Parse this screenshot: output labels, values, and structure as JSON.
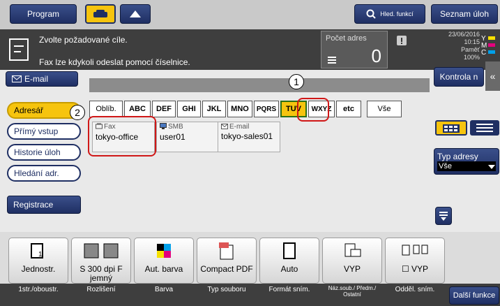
{
  "topbar": {
    "program": "Program",
    "search": "Hled. funkcí",
    "seznam": "Seznam úloh"
  },
  "message": {
    "line1": "Zvolte požadované cíle.",
    "line2": "Fax lze kdykoli odeslat pomocí číselnice.",
    "pocet_label": "Počet adres",
    "pocet_value": "0"
  },
  "status": {
    "date": "23/06/2016",
    "time": "10:15",
    "memory_label": "Paměť",
    "memory_value": "100%"
  },
  "tabs": {
    "email": "E-mail",
    "kontrola": "Kontrola n"
  },
  "sidebar": {
    "items": [
      {
        "label": "Adresář"
      },
      {
        "label": "Přímý vstup"
      },
      {
        "label": "Historie úloh"
      },
      {
        "label": "Hledání adr."
      },
      {
        "label": "Registrace"
      }
    ]
  },
  "index": {
    "items": [
      "Oblíb.",
      "ABC",
      "DEF",
      "GHI",
      "JKL",
      "MNO",
      "PQRS",
      "TUV",
      "WXYZ",
      "etc",
      "Vše"
    ],
    "selected": "TUV"
  },
  "entries": [
    {
      "type": "Fax",
      "name": "tokyo-office"
    },
    {
      "type": "SMB",
      "name": "user01"
    },
    {
      "type": "E-mail",
      "name": "tokyo-sales01"
    }
  ],
  "right_panel": {
    "typ_label": "Typ adresy",
    "typ_value": "Vše"
  },
  "functions": [
    {
      "label": "Jednostr.",
      "sub": "1str./oboustr."
    },
    {
      "label": "S 300 dpi F jemný",
      "sub": "Rozlišení"
    },
    {
      "label": "Aut. barva",
      "sub": "Barva"
    },
    {
      "label": "Compact PDF",
      "sub": "Typ souboru"
    },
    {
      "label": "Auto",
      "sub": "Formát sním."
    },
    {
      "label": "VYP",
      "sub": "Náz.soub./ Předm./ Ostatní"
    },
    {
      "label": "VYP",
      "sub": "Odděl. sním."
    }
  ],
  "dalsi": "Další funkce",
  "callouts": [
    "1",
    "2"
  ]
}
